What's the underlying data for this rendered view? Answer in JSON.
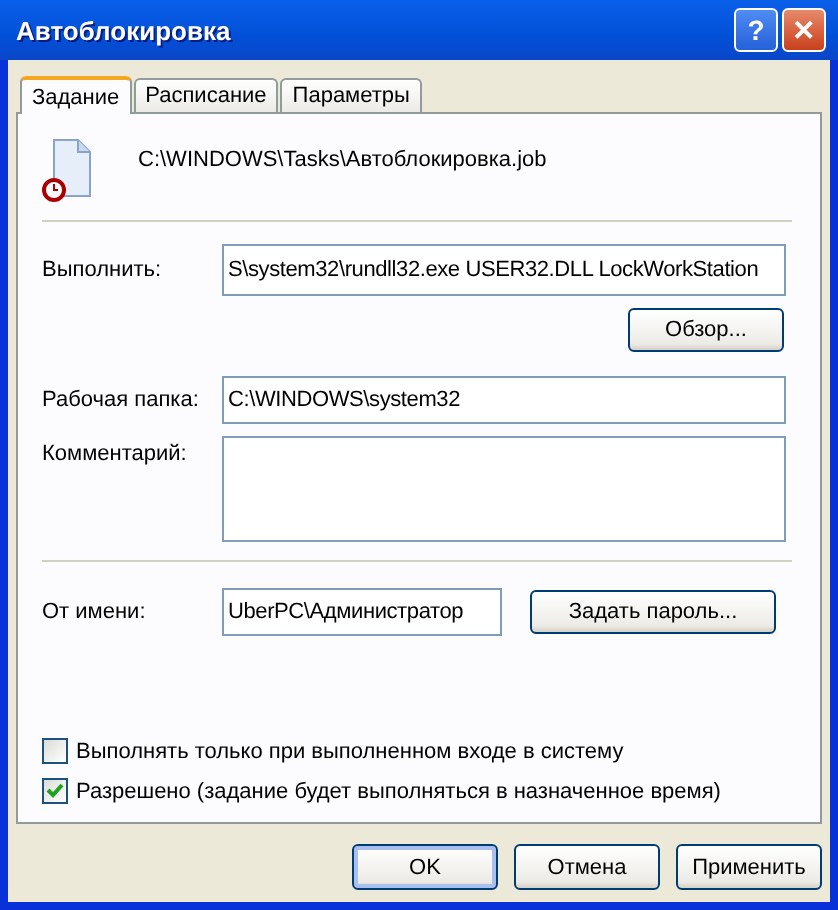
{
  "window": {
    "title": "Автоблокировка"
  },
  "title_buttons": [
    {
      "kind": "help",
      "label": "?"
    },
    {
      "kind": "close",
      "label": "✕"
    }
  ],
  "tabs": [
    {
      "label": "Задание",
      "selected": true
    },
    {
      "label": "Расписание",
      "selected": false
    },
    {
      "label": "Параметры",
      "selected": false
    }
  ],
  "file_path": "C:\\WINDOWS\\Tasks\\Автоблокировка.job",
  "run": {
    "label": "Выполнить:",
    "value": "S\\system32\\rundll32.exe USER32.DLL LockWorkStation",
    "browse_button": "Обзор..."
  },
  "working_folder": {
    "label": "Рабочая папка:",
    "value": "C:\\WINDOWS\\system32"
  },
  "comment": {
    "label": "Комментарий:"
  },
  "run_as": {
    "label": "От имени:",
    "value": "UberPC\\Администратор",
    "password_button": "Задать пароль..."
  },
  "options": [
    {
      "label": "Выполнять только при выполненном входе в систему",
      "checked": false
    },
    {
      "label": "Разрешено (задание будет выполняться в назначенное время)",
      "checked": true
    }
  ],
  "buttons": [
    {
      "label": "OK",
      "default": true
    },
    {
      "label": "Отмена",
      "default": false
    },
    {
      "label": "Применить",
      "default": false
    }
  ]
}
